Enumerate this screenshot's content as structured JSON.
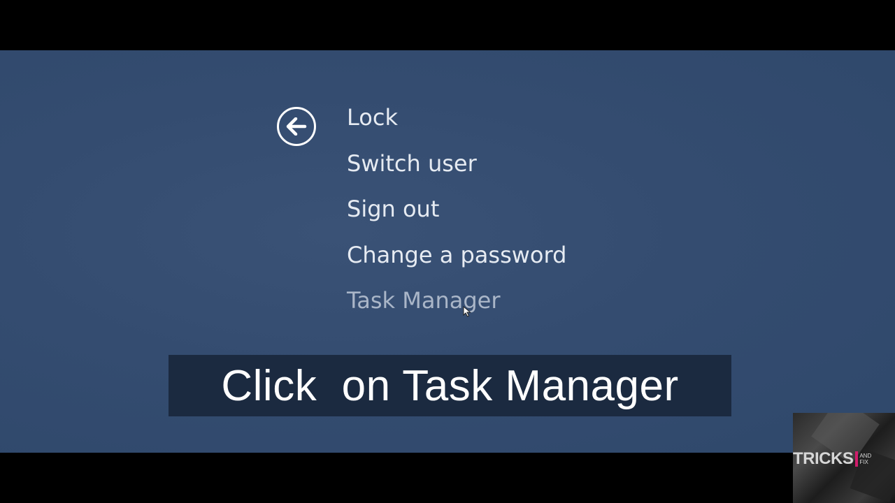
{
  "menu": {
    "back_icon": "arrow-left-icon",
    "items": [
      {
        "label": "Lock"
      },
      {
        "label": "Switch user"
      },
      {
        "label": "Sign out"
      },
      {
        "label": "Change a password"
      },
      {
        "label": "Task Manager"
      }
    ]
  },
  "caption": {
    "text": "Click  on Task Manager"
  },
  "watermark": {
    "main": "TRICKS",
    "small_top": "AND",
    "small_bottom": "FIX"
  },
  "colors": {
    "background": "#344c70",
    "menu_text": "#e6ebf2",
    "caption_bg": "#1b2a40",
    "brand_accent": "#d01c6b"
  }
}
